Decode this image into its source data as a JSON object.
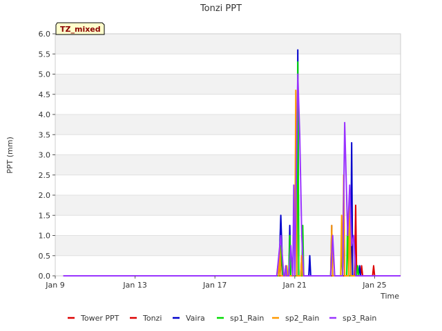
{
  "chart_data": {
    "type": "line",
    "title": "Tonzi PPT",
    "badge": "TZ_mixed",
    "xlabel": "Time",
    "ylabel": "PPT (mm)",
    "x_start": "Jan 9",
    "x_end": "Jan 26.3",
    "xlim": [
      9,
      26.3
    ],
    "ylim": [
      0,
      6
    ],
    "yticks": [
      0.0,
      0.5,
      1.0,
      1.5,
      2.0,
      2.5,
      3.0,
      3.5,
      4.0,
      4.5,
      5.0,
      5.5,
      6.0
    ],
    "ytick_labels": [
      "0.0",
      "0.5",
      "1.0",
      "1.5",
      "2.0",
      "2.5",
      "3.0",
      "3.5",
      "4.0",
      "4.5",
      "5.0",
      "5.5",
      "6.0"
    ],
    "xticks": [
      9,
      13,
      17,
      21,
      25
    ],
    "xtick_labels": [
      "Jan 9",
      "Jan 13",
      "Jan 17",
      "Jan 21",
      "Jan 25"
    ],
    "grid": true,
    "legend_position": "bottom",
    "series": [
      {
        "name": "Tower PPT",
        "color": "#dd0000",
        "points": [
          [
            9.4,
            0
          ],
          [
            25,
            0
          ],
          [
            25,
            0
          ],
          [
            25,
            0
          ]
        ]
      },
      {
        "name": "Tonzi",
        "color": "#dd0000",
        "points": [
          [
            9.4,
            0
          ],
          [
            20.2,
            0
          ],
          [
            20.3,
            0.5
          ],
          [
            20.4,
            0
          ],
          [
            20.7,
            0
          ],
          [
            20.75,
            0.5
          ],
          [
            20.8,
            0
          ],
          [
            21.3,
            0
          ],
          [
            21.35,
            0.5
          ],
          [
            21.4,
            0
          ],
          [
            23.8,
            0
          ],
          [
            23.85,
            2.0
          ],
          [
            23.9,
            0
          ],
          [
            24.0,
            0
          ],
          [
            24.05,
            1.75
          ],
          [
            24.1,
            0
          ],
          [
            24.3,
            0
          ],
          [
            24.35,
            0.25
          ],
          [
            24.4,
            0
          ],
          [
            24.9,
            0
          ],
          [
            24.95,
            0.25
          ],
          [
            25.0,
            0
          ],
          [
            26.3,
            0
          ]
        ]
      },
      {
        "name": "Vaira",
        "color": "#0000cc",
        "points": [
          [
            9.4,
            0
          ],
          [
            20.2,
            0
          ],
          [
            20.3,
            1.5
          ],
          [
            20.4,
            0
          ],
          [
            20.7,
            0
          ],
          [
            20.75,
            1.25
          ],
          [
            20.8,
            0
          ],
          [
            21.1,
            0
          ],
          [
            21.15,
            5.6
          ],
          [
            21.2,
            0
          ],
          [
            21.7,
            0
          ],
          [
            21.75,
            0.5
          ],
          [
            21.8,
            0
          ],
          [
            22.8,
            0
          ],
          [
            22.85,
            1.25
          ],
          [
            22.9,
            0
          ],
          [
            23.4,
            0
          ],
          [
            23.45,
            2.0
          ],
          [
            23.5,
            0
          ],
          [
            23.8,
            0
          ],
          [
            23.85,
            3.3
          ],
          [
            23.9,
            0
          ],
          [
            24.2,
            0
          ],
          [
            24.25,
            0.25
          ],
          [
            24.3,
            0
          ],
          [
            26.3,
            0
          ]
        ]
      },
      {
        "name": "sp1_Rain",
        "color": "#00dd00",
        "points": [
          [
            9.4,
            0
          ],
          [
            20.2,
            0
          ],
          [
            20.3,
            0.75
          ],
          [
            20.4,
            0
          ],
          [
            20.5,
            0
          ],
          [
            20.55,
            0.25
          ],
          [
            20.6,
            0
          ],
          [
            20.7,
            0
          ],
          [
            20.75,
            1.0
          ],
          [
            20.8,
            0
          ],
          [
            21.1,
            0
          ],
          [
            21.15,
            5.3
          ],
          [
            21.2,
            0
          ],
          [
            21.35,
            0
          ],
          [
            21.4,
            1.25
          ],
          [
            21.45,
            0
          ],
          [
            22.8,
            0
          ],
          [
            22.85,
            1.0
          ],
          [
            22.9,
            0
          ],
          [
            23.3,
            0
          ],
          [
            23.35,
            0.75
          ],
          [
            23.4,
            0
          ],
          [
            23.45,
            1.75
          ],
          [
            23.5,
            0
          ],
          [
            23.6,
            0
          ],
          [
            23.65,
            1.5
          ],
          [
            23.7,
            0
          ],
          [
            24.1,
            0
          ],
          [
            24.15,
            0.25
          ],
          [
            24.2,
            0
          ],
          [
            26.3,
            0
          ]
        ]
      },
      {
        "name": "sp2_Rain",
        "color": "#ff9900",
        "points": [
          [
            9.4,
            0
          ],
          [
            20.1,
            0
          ],
          [
            20.15,
            0.25
          ],
          [
            20.2,
            0
          ],
          [
            20.25,
            0.75
          ],
          [
            20.3,
            0
          ],
          [
            20.55,
            0
          ],
          [
            20.6,
            0.25
          ],
          [
            20.65,
            0
          ],
          [
            21.0,
            0
          ],
          [
            21.05,
            4.6
          ],
          [
            21.1,
            0
          ],
          [
            21.3,
            0
          ],
          [
            21.35,
            0.5
          ],
          [
            21.4,
            0
          ],
          [
            22.8,
            0
          ],
          [
            22.85,
            1.25
          ],
          [
            22.9,
            0
          ],
          [
            23.3,
            0
          ],
          [
            23.35,
            1.5
          ],
          [
            23.4,
            0
          ],
          [
            23.45,
            2.5
          ],
          [
            23.5,
            0
          ],
          [
            23.7,
            0
          ],
          [
            23.75,
            2.0
          ],
          [
            23.8,
            0
          ],
          [
            26.3,
            0
          ]
        ]
      },
      {
        "name": "sp3_Rain",
        "color": "#9933ff",
        "points": [
          [
            9.4,
            0
          ],
          [
            20.1,
            0
          ],
          [
            20.3,
            1.0
          ],
          [
            20.45,
            0
          ],
          [
            20.5,
            0
          ],
          [
            20.55,
            0.25
          ],
          [
            20.6,
            0
          ],
          [
            20.7,
            0
          ],
          [
            20.8,
            0.75
          ],
          [
            20.9,
            0
          ],
          [
            20.95,
            2.25
          ],
          [
            21.0,
            0
          ],
          [
            21.05,
            1.5
          ],
          [
            21.15,
            5.0
          ],
          [
            21.25,
            3.5
          ],
          [
            21.35,
            1.0
          ],
          [
            21.45,
            0
          ],
          [
            22.8,
            0
          ],
          [
            22.9,
            1.0
          ],
          [
            23.0,
            0
          ],
          [
            23.4,
            0
          ],
          [
            23.5,
            3.8
          ],
          [
            23.65,
            1.0
          ],
          [
            23.75,
            2.25
          ],
          [
            23.85,
            0.75
          ],
          [
            23.95,
            1.0
          ],
          [
            24.05,
            0
          ],
          [
            26.3,
            0
          ]
        ]
      }
    ]
  }
}
